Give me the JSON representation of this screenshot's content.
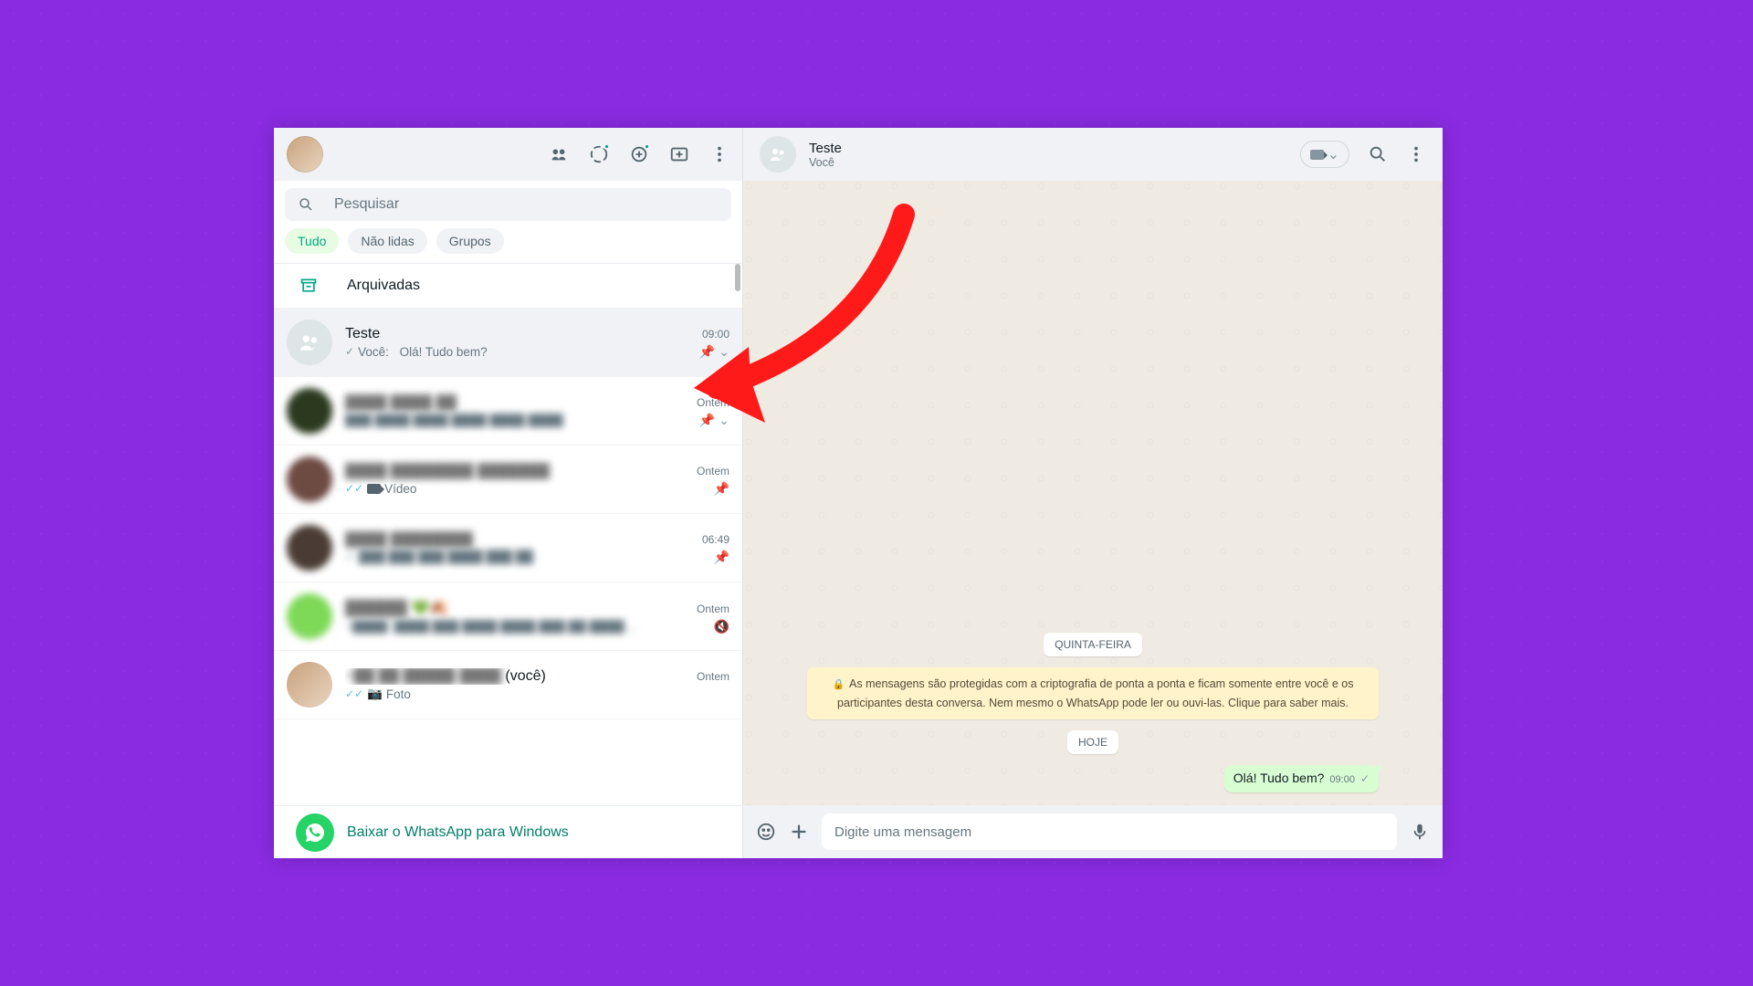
{
  "search": {
    "placeholder": "Pesquisar"
  },
  "filters": {
    "all": "Tudo",
    "unread": "Não lidas",
    "groups": "Grupos"
  },
  "archived": {
    "label": "Arquivadas"
  },
  "chats": [
    {
      "name": "Teste",
      "time": "09:00",
      "prev_prefix": "Você:",
      "preview": "Olá! Tudo bem?",
      "sel": true,
      "pinned": true,
      "tick": "single"
    }
  ],
  "chat_rows": {
    "r2": {
      "time": "Ontem"
    },
    "r3": {
      "time": "Ontem",
      "preview_label": "Vídeo"
    },
    "r4": {
      "time": "06:49"
    },
    "r5": {
      "time": "Ontem"
    },
    "r6": {
      "name_suffix": "(você)",
      "time": "Ontem",
      "preview_label": "Foto"
    }
  },
  "download_bar": {
    "text": "Baixar o WhatsApp para Windows"
  },
  "right_header": {
    "title": "Teste",
    "subtitle": "Você"
  },
  "conversation": {
    "date1": "QUINTA-FEIRA",
    "encryption": "As mensagens são protegidas com a criptografia de ponta a ponta e ficam somente entre você e os participantes desta conversa. Nem mesmo o WhatsApp pode ler ou ouvi-las. Clique para saber mais.",
    "date2": "HOJE",
    "msg1": {
      "text": "Olá! Tudo bem?",
      "time": "09:00"
    }
  },
  "compose": {
    "placeholder": "Digite uma mensagem"
  }
}
